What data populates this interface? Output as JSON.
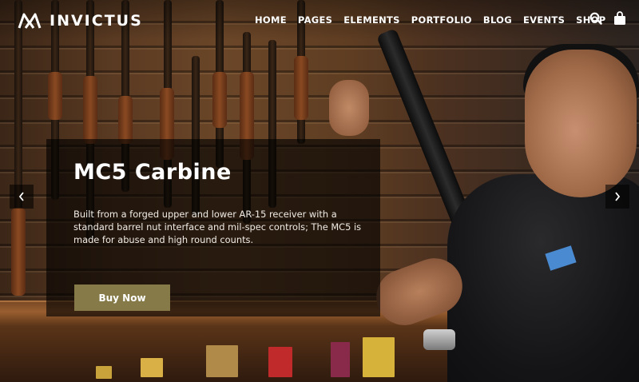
{
  "header": {
    "logo_text": "INVICTUS",
    "nav": [
      "HOME",
      "PAGES",
      "ELEMENTS",
      "PORTFOLIO",
      "BLOG",
      "EVENTS",
      "SHOP"
    ],
    "icons": [
      "search-icon",
      "shopping-bag-icon"
    ]
  },
  "slide": {
    "title": "MC5 Carbine",
    "description": "Built from a forged upper and lower AR-15 receiver with a standard barrel nut interface and mil-spec controls; The MC5 is made for abuse and high round counts.",
    "button_label": "Buy Now"
  },
  "slider_controls": {
    "prev_icon": "chevron-left-icon",
    "next_icon": "chevron-right-icon"
  },
  "colors": {
    "button_bg": "#857a48",
    "panel_bg": "rgba(0,0,0,0.62)",
    "text": "#ffffff"
  }
}
